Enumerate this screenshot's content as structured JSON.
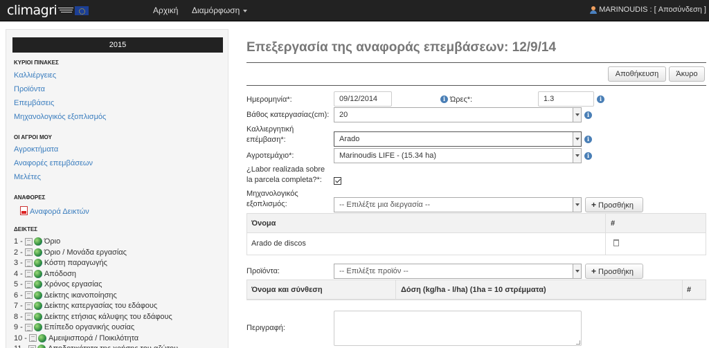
{
  "navbar": {
    "brand": "climagri",
    "home": "Αρχική",
    "config": "Διαμόρφωση",
    "user": "MARINOUDIS : [ Αποσύνδεση ]"
  },
  "sidebar": {
    "year": "2015",
    "sections": {
      "main_tables": "ΚΥΡΙΟΙ ΠΙΝΑΚΕΣ",
      "my_farms": "ΟΙ ΑΓΡΟΙ ΜΟΥ",
      "reports": "ΑΝΑΦΟΡΕΣ",
      "indicators": "ΔΕΙΚΤΕΣ"
    },
    "main_links": [
      "Καλλιέργειες",
      "Προϊόντα",
      "Επεμβάσεις",
      "Μηχανολογικός εξοπλισμός"
    ],
    "farm_links": [
      "Αγροκτήματα",
      "Αναφορές επεμβάσεων",
      "Μελέτες"
    ],
    "report_link": "Αναφορά Δεικτών",
    "indicators": [
      {
        "num": "1 -",
        "label": "Όριο"
      },
      {
        "num": "2 -",
        "label": "Όριο / Μονάδα εργασίας"
      },
      {
        "num": "3 -",
        "label": "Κόστη παραγωγής"
      },
      {
        "num": "4 -",
        "label": "Απόδοση"
      },
      {
        "num": "5 -",
        "label": "Χρόνος εργασίας"
      },
      {
        "num": "6 -",
        "label": "Δείκτης ικανοποίησης"
      },
      {
        "num": "7 -",
        "label": "Δείκτης κατεργασίας του εδάφους"
      },
      {
        "num": "8 -",
        "label": "Δείκτης ετήσιας κάλυψης του εδάφους"
      },
      {
        "num": "9 -",
        "label": "Επίπεδο οργανικής ουσίας"
      },
      {
        "num": "10 -",
        "label": "Αμειψισπορά / Ποικιλότητα"
      },
      {
        "num": "11 -",
        "label": "Αποδοτικότητα της χρήσης του αζώτου"
      }
    ]
  },
  "main": {
    "title": "Επεξεργασία της αναφοράς επεμβάσεων: 12/9/14",
    "save": "Αποθήκευση",
    "cancel": "Άκυρο",
    "date_label": "Ημερομηνία*:",
    "date_value": "09/12/2014",
    "hours_label": "Ώρες*:",
    "hours_value": "1.3",
    "depth_label": "Βάθος κατεργασίας(cm):",
    "depth_value": "20",
    "operation_label_1": "Καλλιεργητική",
    "operation_label_2": "επέμβαση*:",
    "operation_value": "Arado",
    "plot_label": "Αγροτεμάχιο*:",
    "plot_value": "Marinoudis LIFE - (15.34 ha)",
    "complete_label_1": "¿Labor realizada sobre",
    "complete_label_2": "la parcela completa?*:",
    "machinery_label_1": "Μηχανολογικός",
    "machinery_label_2": "εξοπλισμός:",
    "machinery_placeholder": "-- Επιλέξτε μια διεργασία --",
    "add_label": "Προσθήκη",
    "machinery_table": {
      "col_name": "Όνομα",
      "col_hash": "#",
      "rows": [
        "Arado de discos"
      ]
    },
    "products_label": "Προϊόντα:",
    "products_placeholder": "-- Επιλέξτε προϊόν --",
    "products_table": {
      "col_name": "Όνομα και σύνθεση",
      "col_dose": "Δόση (kg/ha - l/ha) (1ha = 10 στρέμματα)",
      "col_hash": "#"
    },
    "description_label": "Περιγραφή:"
  }
}
